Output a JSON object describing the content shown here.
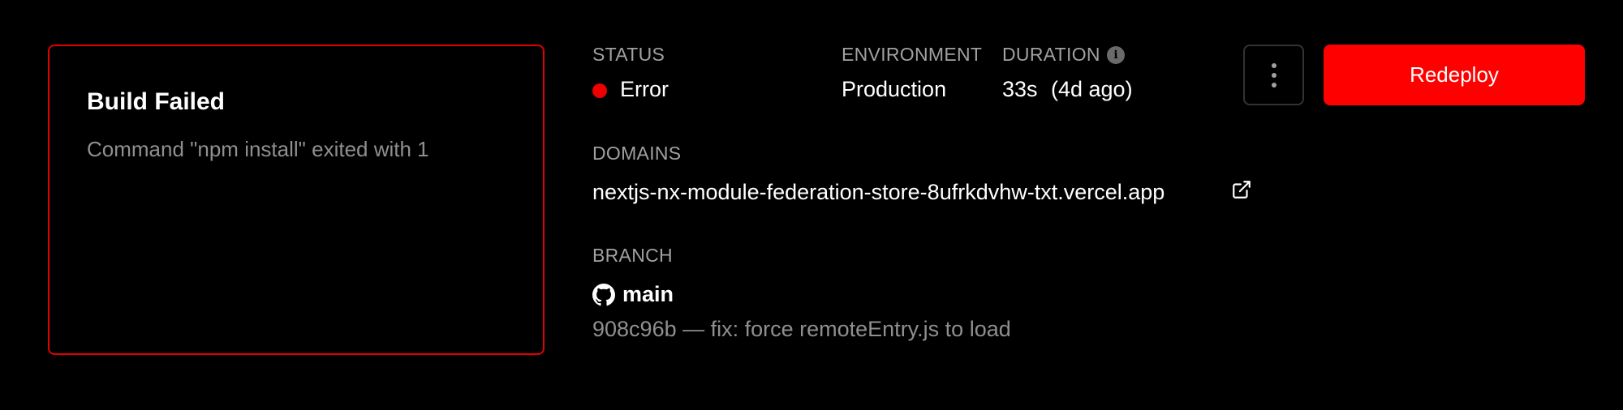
{
  "error_card": {
    "title": "Build Failed",
    "message": "Command \"npm install\" exited with 1"
  },
  "status": {
    "label": "STATUS",
    "value": "Error",
    "color": "#ee0000"
  },
  "environment": {
    "label": "ENVIRONMENT",
    "value": "Production"
  },
  "duration": {
    "label": "DURATION",
    "value": "33s",
    "relative": "(4d ago)",
    "info_icon": "info-icon"
  },
  "actions": {
    "more_icon": "more-vertical-icon",
    "redeploy_label": "Redeploy",
    "accent": "#ff0000"
  },
  "domains": {
    "label": "DOMAINS",
    "items": [
      "nextjs-nx-module-federation-store-8ufrkdvhw-txt.vercel.app"
    ],
    "link_icon": "external-link-icon"
  },
  "branch": {
    "label": "BRANCH",
    "icon": "github-icon",
    "name": "main",
    "commit": "908c96b — fix: force remoteEntry.js to load"
  }
}
